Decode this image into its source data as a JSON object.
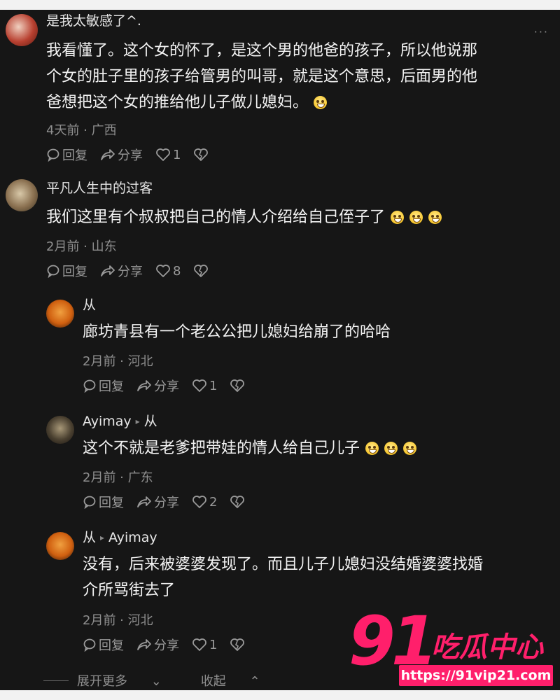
{
  "more_label": "···",
  "comments": [
    {
      "username": "是我太敏感了^.",
      "lines": [
        "我看懂了。这个女的怀了，是这个男的他爸的孩子，所以他说那",
        "个女的肚子里的孩子给管男的叫哥，就是这个意思，后面男的他",
        "爸想把这个女的推给他儿子做儿媳妇。"
      ],
      "meta": "4天前 · 广西",
      "reply_label": "回复",
      "share_label": "分享",
      "likes": "1"
    },
    {
      "username": "平凡人生中的过客",
      "lines": [
        "我们这里有个叔叔把自己的情人介绍给自己侄子了"
      ],
      "meta": "2月前 · 山东",
      "reply_label": "回复",
      "share_label": "分享",
      "likes": "8"
    },
    {
      "username": "从",
      "lines": [
        "廊坊青县有一个老公公把儿媳妇给崩了的哈哈"
      ],
      "meta": "2月前 · 河北",
      "reply_label": "回复",
      "share_label": "分享",
      "likes": "1"
    },
    {
      "username": "Ayimay",
      "reply_to": "从",
      "lines": [
        "这个不就是老爹把带娃的情人给自己儿子"
      ],
      "meta": "2月前 · 广东",
      "reply_label": "回复",
      "share_label": "分享",
      "likes": "2"
    },
    {
      "username": "从",
      "reply_to": "Ayimay",
      "lines": [
        "没有，后来被婆婆发现了。而且儿子儿媳妇没结婚婆婆找婚",
        "介所骂街去了"
      ],
      "meta": "2月前 · 河北",
      "reply_label": "回复",
      "share_label": "分享",
      "likes": "1"
    }
  ],
  "footer": {
    "expand_label": "展开更多",
    "collapse_label": "收起"
  },
  "watermark": {
    "number": "91",
    "text": "吃瓜中心",
    "url": "https://91vip21.com"
  },
  "colors": {
    "background": "#161616",
    "text": "#f3f3f3",
    "muted": "#8f8f8f",
    "watermark": "#ff1f6b"
  }
}
